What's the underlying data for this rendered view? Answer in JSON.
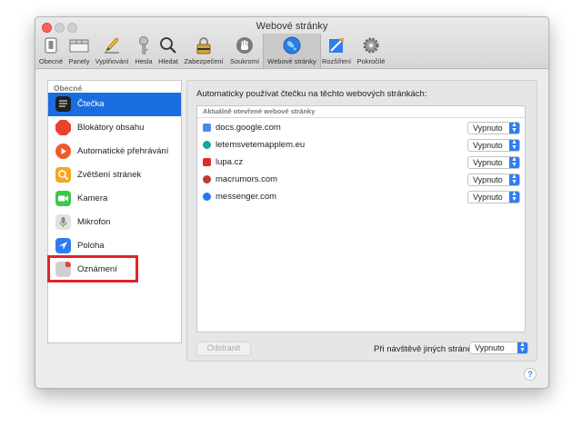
{
  "window": {
    "title": "Webové stránky"
  },
  "toolbar": {
    "items": [
      {
        "label": "Obecné",
        "icon": "switch-icon"
      },
      {
        "label": "Panely",
        "icon": "tabs-icon"
      },
      {
        "label": "Vyplňování",
        "icon": "pencil-icon"
      },
      {
        "label": "Hesla",
        "icon": "key-icon"
      },
      {
        "label": "Hledat",
        "icon": "magnifier-icon"
      },
      {
        "label": "Zabezpečení",
        "icon": "padlock-icon"
      },
      {
        "label": "Soukromí",
        "icon": "hand-icon"
      },
      {
        "label": "Webové stránky",
        "icon": "globe-icon",
        "active": true
      },
      {
        "label": "Rozšíření",
        "icon": "puzzle-icon"
      },
      {
        "label": "Pokročilé",
        "icon": "gear-icon"
      }
    ]
  },
  "sidebar": {
    "header": "Obecné",
    "items": [
      {
        "label": "Čtečka",
        "icon": "reader-icon",
        "color": "#1f1f1f",
        "selected": true
      },
      {
        "label": "Blokátory obsahu",
        "icon": "stop-sign-icon",
        "color": "#e8432e"
      },
      {
        "label": "Automatické přehrávání",
        "icon": "play-icon",
        "color": "#f05a28"
      },
      {
        "label": "Zvětšení stránek",
        "icon": "zoom-icon",
        "color": "#f5a623"
      },
      {
        "label": "Kamera",
        "icon": "camera-icon",
        "color": "#3cc84a"
      },
      {
        "label": "Mikrofon",
        "icon": "microphone-icon",
        "color": "#c8c8c8"
      },
      {
        "label": "Poloha",
        "icon": "location-icon",
        "color": "#2f7df0"
      },
      {
        "label": "Oznámení",
        "icon": "notification-icon",
        "color": "#cfcfcf"
      }
    ]
  },
  "main": {
    "heading": "Automaticky používat čtečku na těchto webových stránkách:",
    "sites_header": "Aktuálně otevřené webové stránky",
    "sites": [
      {
        "url": "docs.google.com",
        "value": "Vypnuto",
        "fav_color": "#4a88f0"
      },
      {
        "url": "letemsvetemapplem.eu",
        "value": "Vypnuto",
        "fav_color": "#1aa3a0"
      },
      {
        "url": "lupa.cz",
        "value": "Vypnuto",
        "fav_color": "#e02b2b"
      },
      {
        "url": "macrumors.com",
        "value": "Vypnuto",
        "fav_color": "#c0392b"
      },
      {
        "url": "messenger.com",
        "value": "Vypnuto",
        "fav_color": "#1f7cf2"
      }
    ],
    "remove_label": "Odstranit",
    "other_label": "Při návštěvě jiných stránek:",
    "other_value": "Vypnuto"
  },
  "help_label": "?"
}
